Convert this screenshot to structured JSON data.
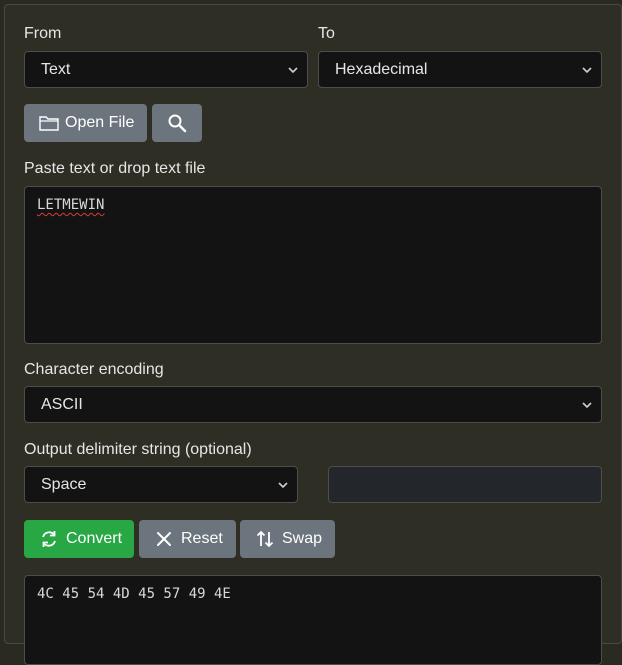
{
  "from": {
    "label": "From",
    "selected": "Text"
  },
  "to": {
    "label": "To",
    "selected": "Hexadecimal"
  },
  "toolbar": {
    "open_file_label": "Open File",
    "search_icon": "magnifier-icon",
    "folder_icon": "folder-icon"
  },
  "input": {
    "label": "Paste text or drop text file",
    "value": "LETMEWIN"
  },
  "encoding": {
    "label": "Character encoding",
    "selected": "ASCII"
  },
  "delimiter": {
    "label": "Output delimiter string (optional)",
    "selected": "Space",
    "custom_value": ""
  },
  "actions": {
    "convert_label": "Convert",
    "reset_label": "Reset",
    "swap_label": "Swap",
    "convert_icon": "refresh-icon",
    "reset_icon": "close-icon",
    "swap_icon": "swap-vertical-icon"
  },
  "output": {
    "value": "4C 45 54 4D 45 57 49 4E"
  },
  "colors": {
    "panel_bg": "#2f2e24",
    "field_bg": "#131313",
    "btn_gray": "#6c757d",
    "btn_green": "#28a745",
    "text": "#e6e6e6"
  }
}
